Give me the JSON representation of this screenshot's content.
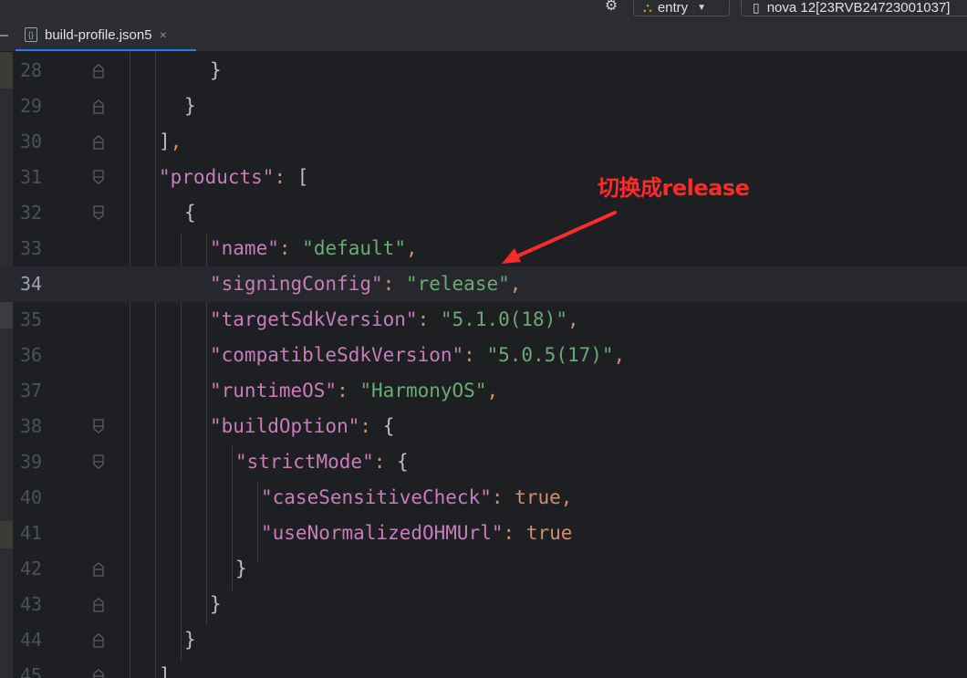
{
  "toolbar": {
    "gear_icon": "gear-icon",
    "module_label": "entry",
    "device_label": "nova 12[23RVB24723001037]"
  },
  "tab": {
    "filename": "build-profile.json5",
    "close_glyph": "×"
  },
  "editor": {
    "current_line": "34",
    "lines": [
      {
        "n": "28",
        "fold": "end"
      },
      {
        "n": "29",
        "fold": "end"
      },
      {
        "n": "30",
        "fold": "end"
      },
      {
        "n": "31",
        "fold": "start"
      },
      {
        "n": "32",
        "fold": "start"
      },
      {
        "n": "33",
        "fold": ""
      },
      {
        "n": "34",
        "fold": ""
      },
      {
        "n": "35",
        "fold": ""
      },
      {
        "n": "36",
        "fold": ""
      },
      {
        "n": "37",
        "fold": ""
      },
      {
        "n": "38",
        "fold": "start"
      },
      {
        "n": "39",
        "fold": "start"
      },
      {
        "n": "40",
        "fold": ""
      },
      {
        "n": "41",
        "fold": ""
      },
      {
        "n": "42",
        "fold": "end"
      },
      {
        "n": "43",
        "fold": "end"
      },
      {
        "n": "44",
        "fold": "end"
      },
      {
        "n": "45",
        "fold": "end"
      }
    ],
    "code": {
      "l28": "}",
      "l29": "}",
      "l30_bracket": "]",
      "l30_comma": ",",
      "l31_key": "\"products\"",
      "l31_colon": ":",
      "l31_bracket": "[",
      "l32": "{",
      "l33_key": "\"name\"",
      "l33_colon": ":",
      "l33_val": "\"default\"",
      "l33_comma": ",",
      "l34_key": "\"signingConfig\"",
      "l34_colon": ":",
      "l34_val": "\"release\"",
      "l34_comma": ",",
      "l35_key": "\"targetSdkVersion\"",
      "l35_colon": ":",
      "l35_val": "\"5.1.0(18)\"",
      "l35_comma": ",",
      "l36_key": "\"compatibleSdkVersion\"",
      "l36_colon": ":",
      "l36_val": "\"5.0.5(17)\"",
      "l36_comma": ",",
      "l37_key": "\"runtimeOS\"",
      "l37_colon": ":",
      "l37_val": "\"HarmonyOS\"",
      "l37_comma": ",",
      "l38_key": "\"buildOption\"",
      "l38_colon": ":",
      "l38_brace": "{",
      "l39_key": "\"strictMode\"",
      "l39_colon": ":",
      "l39_brace": "{",
      "l40_key": "\"caseSensitiveCheck\"",
      "l40_colon": ":",
      "l40_val": "true",
      "l40_comma": ",",
      "l41_key": "\"useNormalizedOHMUrl\"",
      "l41_colon": ":",
      "l41_val": "true",
      "l42": "}",
      "l43": "}",
      "l44": "}",
      "l45": "],"
    }
  },
  "annotation": {
    "text": "切换成release",
    "color": "#ff2a2a"
  },
  "colors": {
    "key": "#c77dbb",
    "string": "#6aab73",
    "keyword": "#cf8e6d",
    "background": "#1e1f22",
    "accent": "#3574f0"
  }
}
